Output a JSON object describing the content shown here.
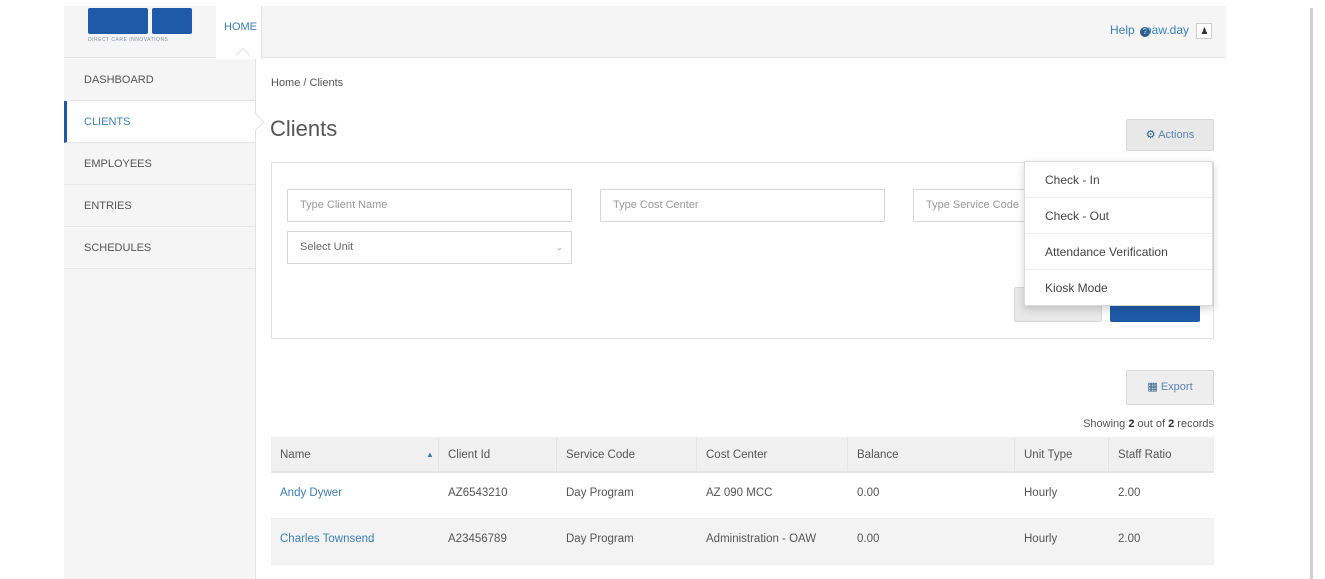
{
  "header": {
    "logo_text": "DIRECT CARE INNOVATIONS",
    "home_tab": "HOME",
    "help_label": "Help",
    "username": "oaw.day"
  },
  "sidebar": {
    "items": [
      {
        "label": "DASHBOARD"
      },
      {
        "label": "CLIENTS"
      },
      {
        "label": "EMPLOYEES"
      },
      {
        "label": "ENTRIES"
      },
      {
        "label": "SCHEDULES"
      }
    ]
  },
  "main": {
    "breadcrumb": "Home / Clients",
    "title": "Clients",
    "actions_label": "Actions",
    "filters": {
      "client_name_placeholder": "Type Client Name",
      "cost_center_placeholder": "Type Cost Center",
      "service_code_placeholder": "Type Service Code",
      "unit_select_value": "Select Unit"
    },
    "actions_menu": [
      {
        "label": "Check - In"
      },
      {
        "label": "Check - Out"
      },
      {
        "label": "Attendance Verification"
      },
      {
        "label": "Kiosk Mode"
      }
    ],
    "export_label": "Export",
    "showing": {
      "prefix": "Showing ",
      "count": "2",
      "middle": " out of ",
      "total": "2",
      "suffix": " records"
    },
    "table": {
      "headers": [
        "Name",
        "Client Id",
        "Service Code",
        "Cost Center",
        "Balance",
        "Unit Type",
        "Staff Ratio"
      ],
      "rows": [
        [
          "Andy Dywer",
          "AZ6543210",
          "Day Program",
          "AZ 090 MCC",
          "0.00",
          "Hourly",
          "2.00"
        ],
        [
          "Charles Townsend",
          "A23456789",
          "Day Program",
          "Administration - OAW",
          "0.00",
          "Hourly",
          "2.00"
        ]
      ]
    }
  },
  "colors": {
    "accent": "#1e5aa8",
    "link": "#3a7fc1"
  }
}
